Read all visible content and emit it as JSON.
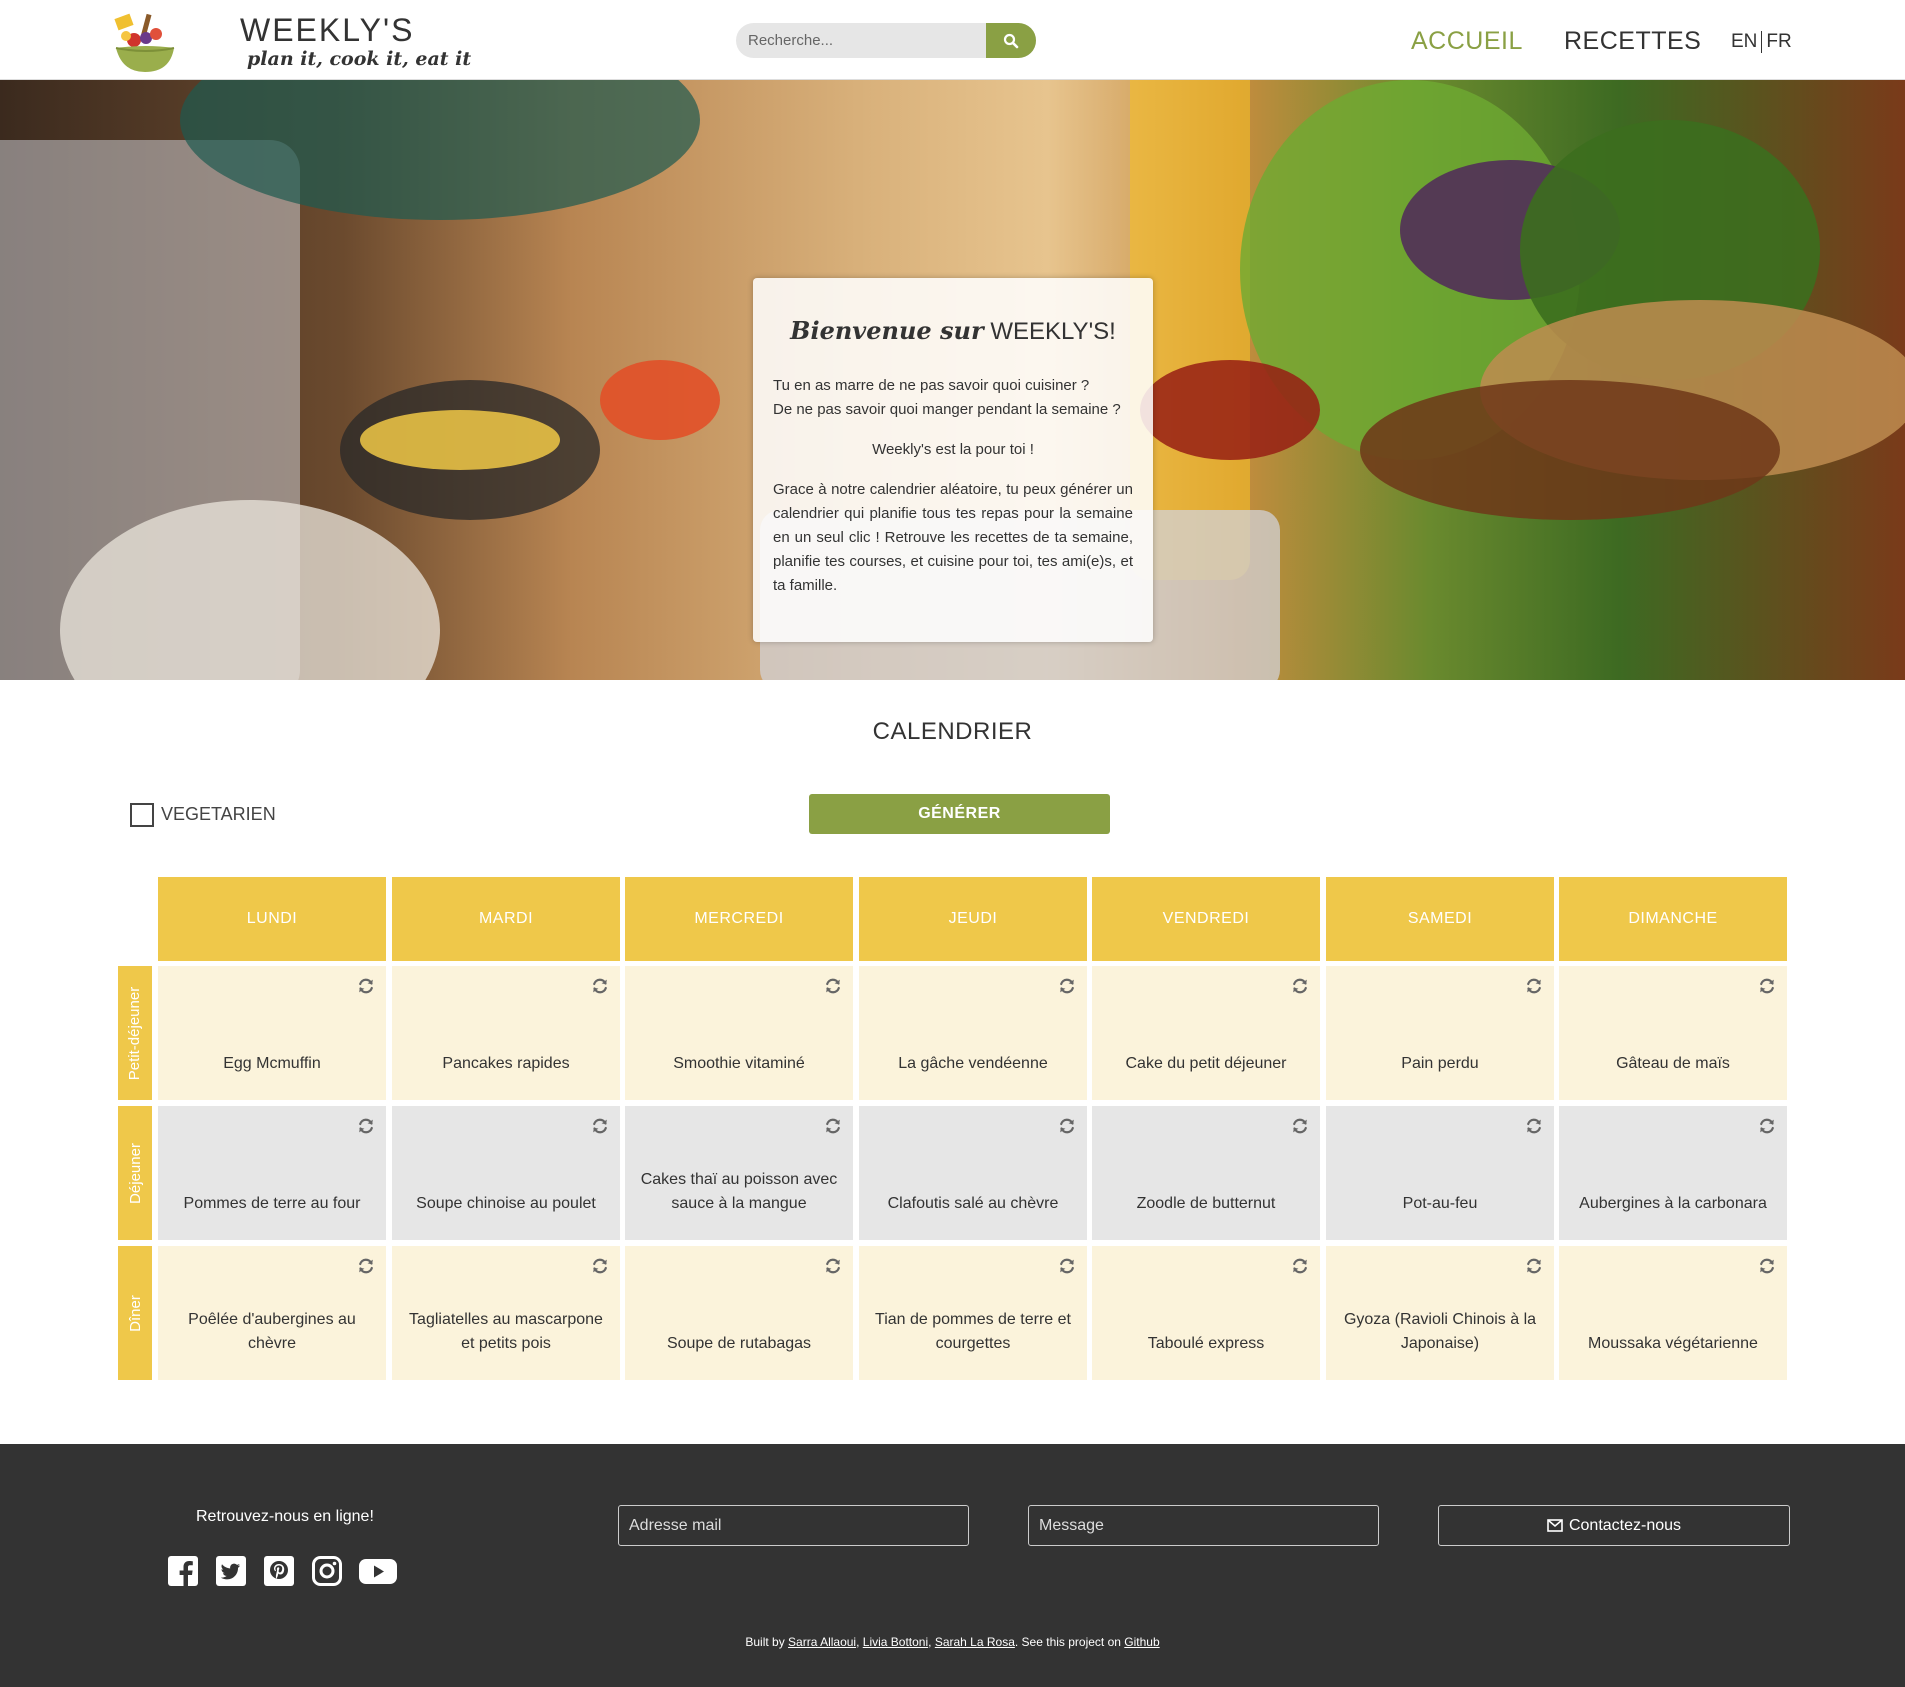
{
  "header": {
    "brand": "WEEKLY'S",
    "tagline": "plan it, cook it, eat it",
    "search_placeholder": "Recherche...",
    "nav": {
      "home": "ACCUEIL",
      "recipes": "RECETTES"
    },
    "lang": {
      "en": "EN",
      "fr": "FR"
    },
    "accent_color": "#8aa044"
  },
  "hero": {
    "title_script": "Bienvenue sur",
    "title_brand": "WEEKLY'S!",
    "p1_line1": "Tu en as marre de ne pas savoir quoi cuisiner ?",
    "p1_line2": "De ne pas savoir quoi manger pendant la semaine ?",
    "p2": "Weekly's est la pour toi !",
    "p3": "Grace à notre calendrier aléatoire, tu peux générer un calendrier qui planifie tous tes repas pour la semaine en un seul clic ! Retrouve les recettes de ta semaine, planifie tes courses, et cuisine pour toi, tes ami(e)s, et ta famille."
  },
  "calendar": {
    "title": "CALENDRIER",
    "vegetarian_label": "VEGETARIEN",
    "generate_label": "GÉNÉRER",
    "header_color": "#efc84a",
    "days": [
      "LUNDI",
      "MARDI",
      "MERCREDI",
      "JEUDI",
      "VENDREDI",
      "SAMEDI",
      "DIMANCHE"
    ],
    "meals": [
      {
        "label": "Petit-déjeuner",
        "recipes": [
          "Egg Mcmuffin",
          "Pancakes rapides",
          "Smoothie vitaminé",
          "La gâche vendéenne",
          "Cake du petit déjeuner",
          "Pain perdu",
          "Gâteau de maïs"
        ]
      },
      {
        "label": "Déjeuner",
        "recipes": [
          "Pommes de terre au four",
          "Soupe chinoise au poulet",
          "Cakes thaï au poisson avec sauce à la mangue",
          "Clafoutis salé au chèvre",
          "Zoodle de butternut",
          "Pot-au-feu",
          "Aubergines à la carbonara"
        ]
      },
      {
        "label": "Dîner",
        "recipes": [
          "Poêlée d'aubergines au chèvre",
          "Tagliatelles au mascarpone et petits pois",
          "Soupe de rutabagas",
          "Tian de pommes de terre et courgettes",
          "Taboulé express",
          "Gyoza (Ravioli Chinois à la Japonaise)",
          "Moussaka végétarienne"
        ]
      }
    ]
  },
  "footer": {
    "title": "Retrouvez-nous en ligne!",
    "social": [
      "facebook-icon",
      "twitter-icon",
      "pinterest-icon",
      "instagram-icon",
      "youtube-icon"
    ],
    "email_placeholder": "Adresse mail",
    "message_placeholder": "Message",
    "contact_label": "Contactez-nous",
    "credits_prefix": "Built by",
    "authors": [
      "Sarra Allaoui",
      "Livia Bottoni",
      "Sarah La Rosa"
    ],
    "credits_middle": ". See this project on",
    "github": "Github"
  }
}
